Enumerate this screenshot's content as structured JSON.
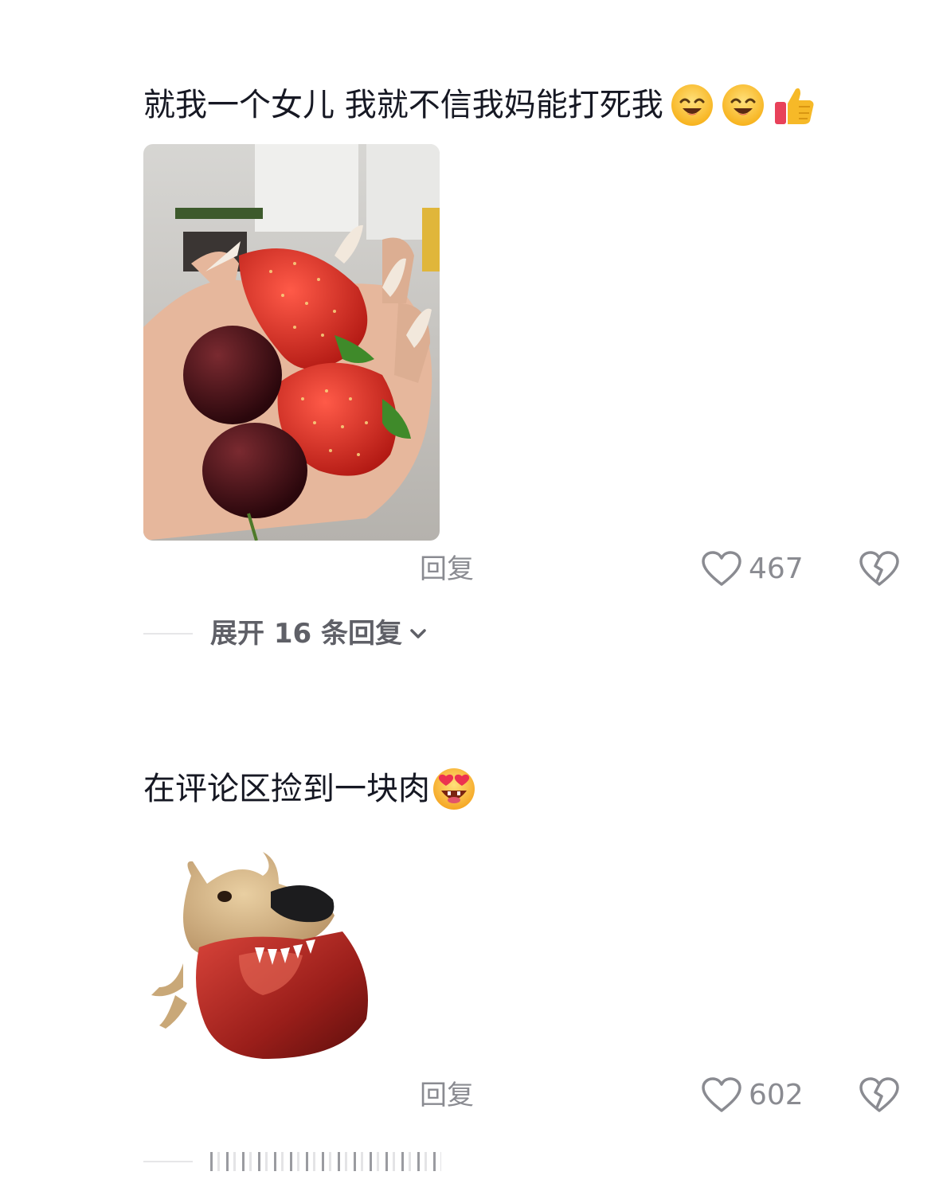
{
  "comments": [
    {
      "text": "就我一个女儿 我就不信我妈能打死我",
      "emojis": [
        "smiling-face-icon",
        "smiling-face-icon",
        "thumbs-up-icon"
      ],
      "image": "hand-holding-strawberries-and-cherries",
      "reply_label": "回复",
      "like_count": "467",
      "expand_label": "展开 16 条回复"
    },
    {
      "text": "在评论区捡到一块肉",
      "emojis": [
        "star-struck-face-icon"
      ],
      "image": "dog-biting-meat-cube",
      "reply_label": "回复",
      "like_count": "602"
    }
  ],
  "colors": {
    "text": "#161823",
    "muted": "#8a8b91",
    "expand": "#5f6067",
    "divider": "#e6e6e8"
  }
}
